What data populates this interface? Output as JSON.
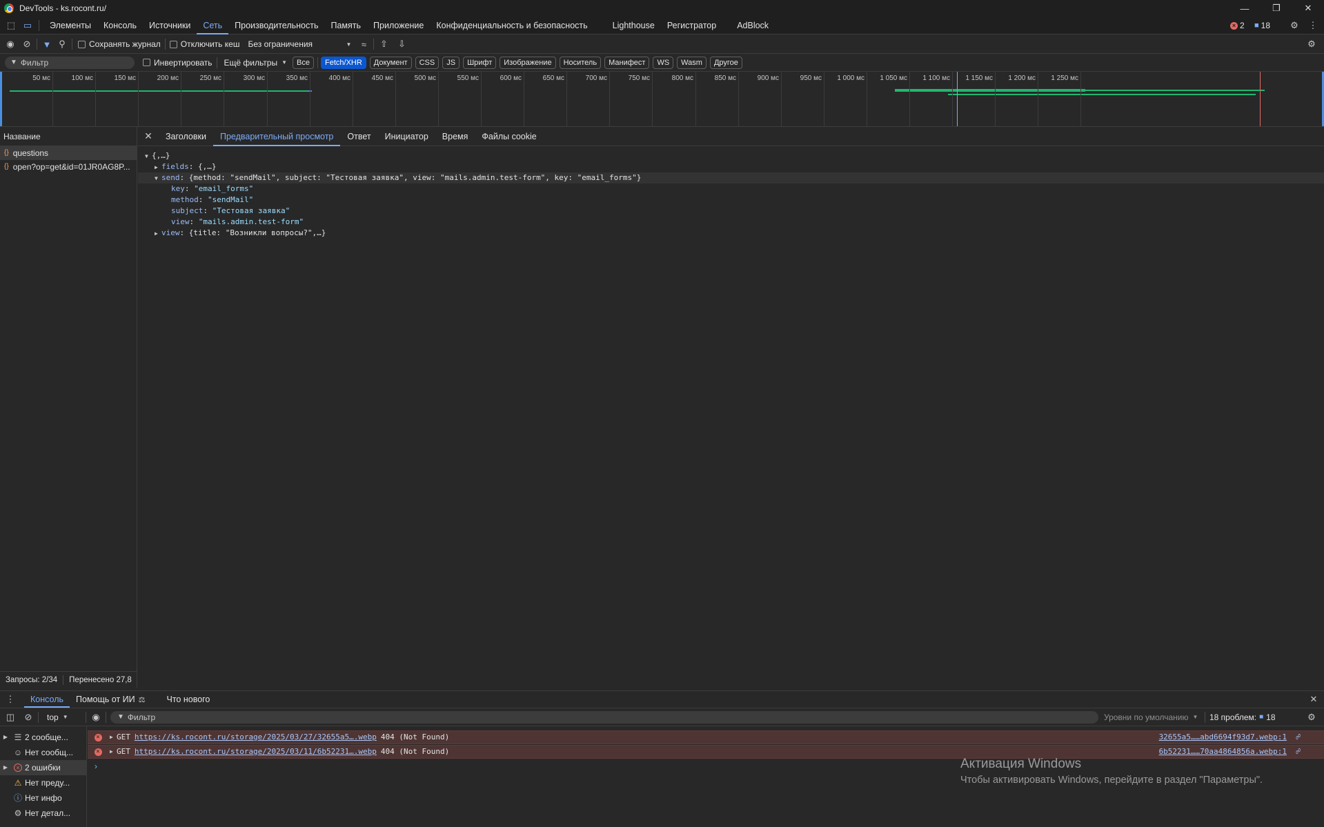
{
  "window": {
    "title": "DevTools - ks.rocont.ru/"
  },
  "main_tabs": [
    "Элементы",
    "Консоль",
    "Источники",
    "Сеть",
    "Производительность",
    "Память",
    "Приложение",
    "Конфиденциальность и безопасность",
    "Lighthouse",
    "Регистратор",
    "AdBlock"
  ],
  "badges": {
    "errors": "2",
    "messages": "18"
  },
  "toolbar": {
    "preserve_log": "Сохранять журнал",
    "disable_cache": "Отключить кеш",
    "throttling": "Без ограничения"
  },
  "filterbar": {
    "placeholder": "Фильтр",
    "invert": "Инвертировать",
    "more_filters": "Ещё фильтры",
    "chips": [
      "Все",
      "Fetch/XHR",
      "Документ",
      "CSS",
      "JS",
      "Шрифт",
      "Изображение",
      "Носитель",
      "Манифест",
      "WS",
      "Wasm",
      "Другое"
    ]
  },
  "overview": {
    "ticks": [
      "50 мс",
      "100 мс",
      "150 мс",
      "200 мс",
      "250 мс",
      "300 мс",
      "350 мс",
      "400 мс",
      "450 мс",
      "500 мс",
      "550 мс",
      "600 мс",
      "650 мс",
      "700 мс",
      "750 мс",
      "800 мс",
      "850 мс",
      "900 мс",
      "950 мс",
      "1 000 мс",
      "1 050 мс",
      "1 100 мс",
      "1 150 мс",
      "1 200 мс",
      "1 250 мс"
    ]
  },
  "requests": {
    "header": "Название",
    "items": [
      "questions",
      "open?op=get&id=01JR0AG8P..."
    ],
    "status_requests": "Запросы: 2/34",
    "status_transferred": "Перенесено 27,8"
  },
  "detail": {
    "tabs": [
      "Заголовки",
      "Предварительный просмотр",
      "Ответ",
      "Инициатор",
      "Время",
      "Файлы cookie"
    ],
    "root": "{,…}",
    "fields_key": "fields",
    "fields_val": "{,…}",
    "send_key": "send",
    "send_summary": "{method: \"sendMail\", subject: \"Тестовая заявка\", view: \"mails.admin.test-form\", key: \"email_forms\"}",
    "send_props": [
      {
        "k": "key",
        "v": "\"email_forms\""
      },
      {
        "k": "method",
        "v": "\"sendMail\""
      },
      {
        "k": "subject",
        "v": "\"Тестовая заявка\""
      },
      {
        "k": "view",
        "v": "\"mails.admin.test-form\""
      }
    ],
    "view_key": "view",
    "view_val": "{title: \"Возникли вопросы?\",…}"
  },
  "drawer": {
    "tabs": [
      "Консоль",
      "Помощь от ИИ",
      "Что нового"
    ],
    "context": "top",
    "filter_placeholder": "Фильтр",
    "levels": "Уровни по умолчанию",
    "issues": "18 проблем:",
    "issues_count": "18"
  },
  "console_side": [
    "2 сообще...",
    "Нет сообщ...",
    "2 ошибки",
    "Нет преду...",
    "Нет инфо",
    "Нет детал..."
  ],
  "console_errors": [
    {
      "method": "GET",
      "url": "https://ks.rocont.ru/storage/2025/03/27/32655a5….webp",
      "status": "404 (Not Found)",
      "source": "32655a5……abd6694f93d7.webp:1"
    },
    {
      "method": "GET",
      "url": "https://ks.rocont.ru/storage/2025/03/11/6b52231….webp",
      "status": "404 (Not Found)",
      "source": "6b52231……70aa4864856a.webp:1"
    }
  ],
  "watermark": {
    "title": "Активация Windows",
    "subtitle": "Чтобы активировать Windows, перейдите в раздел \"Параметры\"."
  },
  "colors": {
    "accent": "#7cacf8",
    "error": "#e46962",
    "waterfall_green": "#1fb870",
    "waterfall_blue": "#4a90e2"
  }
}
